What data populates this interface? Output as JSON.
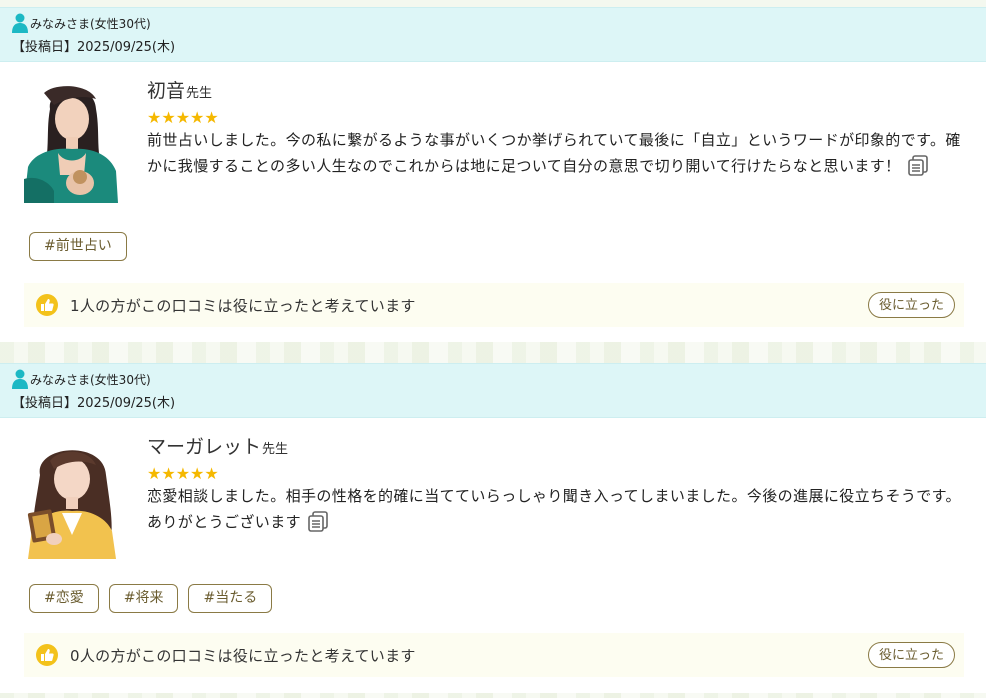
{
  "reviews": [
    {
      "reviewer": "みなみさま(女性30代)",
      "post_date": "【投稿日】2025/09/25(木)",
      "teacher_name": "初音",
      "teacher_suffix": "先生",
      "rating": 5,
      "stars": "★★★★★",
      "comment": "前世占いしました。今の私に繋がるような事がいくつか挙げられていて最後に「自立」というワードが印象的です。確かに我慢することの多い人生なのでこれからは地に足ついて自分の意思で切り開いて行けたらなと思います！",
      "tags": [
        "#前世占い"
      ],
      "helpful_text": "1人の方がこの口コミは役に立ったと考えています",
      "helpful_button": "役に立った"
    },
    {
      "reviewer": "みなみさま(女性30代)",
      "post_date": "【投稿日】2025/09/25(木)",
      "teacher_name": "マーガレット",
      "teacher_suffix": "先生",
      "rating": 5,
      "stars": "★★★★★",
      "comment": "恋愛相談しました。相手の性格を的確に当てていらっしゃり聞き入ってしまいました。今後の進展に役立ちそうです。ありがとうございます",
      "tags": [
        "#恋愛",
        "#将来",
        "#当たる"
      ],
      "helpful_text": "0人の方がこの口コミは役に立ったと考えています",
      "helpful_button": "役に立った"
    }
  ],
  "colors": {
    "header_bg": "#ddf6f7",
    "person_icon": "#1cb8c4",
    "star": "#f5b800",
    "thumb": "#f3c21b",
    "tag_border": "#8a7a45",
    "helpful_bg": "#fdfdf1"
  },
  "icons": {
    "reviewer": "person-icon",
    "copy": "copy-icon",
    "helpful": "thumbs-up-icon"
  }
}
